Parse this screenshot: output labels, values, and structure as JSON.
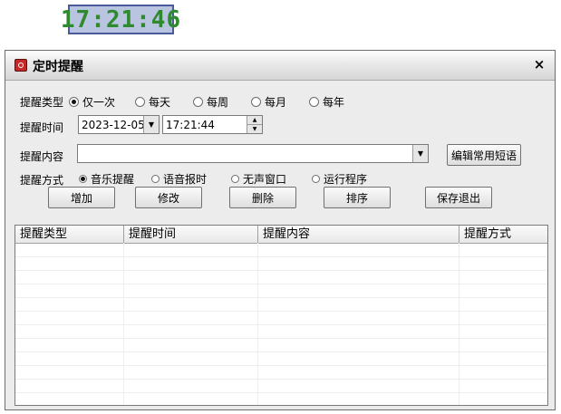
{
  "clock": {
    "time": "17:21:46"
  },
  "window": {
    "title": "定时提醒",
    "close_icon": "×"
  },
  "form": {
    "reminder_type": {
      "label": "提醒类型",
      "options": [
        "仅一次",
        "每天",
        "每周",
        "每月",
        "每年"
      ],
      "selected": "仅一次"
    },
    "reminder_time": {
      "label": "提醒时间",
      "date": "2023-12-05",
      "time": "17:21:44"
    },
    "reminder_content": {
      "label": "提醒内容",
      "value": "",
      "edit_button": "编辑常用短语"
    },
    "reminder_method": {
      "label": "提醒方式",
      "options": [
        "音乐提醒",
        "语音报时",
        "无声窗口",
        "运行程序"
      ],
      "selected": "音乐提醒"
    }
  },
  "buttons": {
    "add": "增加",
    "modify": "修改",
    "delete": "删除",
    "sort": "排序",
    "save_exit": "保存退出"
  },
  "list": {
    "columns": [
      "提醒类型",
      "提醒时间",
      "提醒内容",
      "提醒方式"
    ],
    "rows": []
  }
}
